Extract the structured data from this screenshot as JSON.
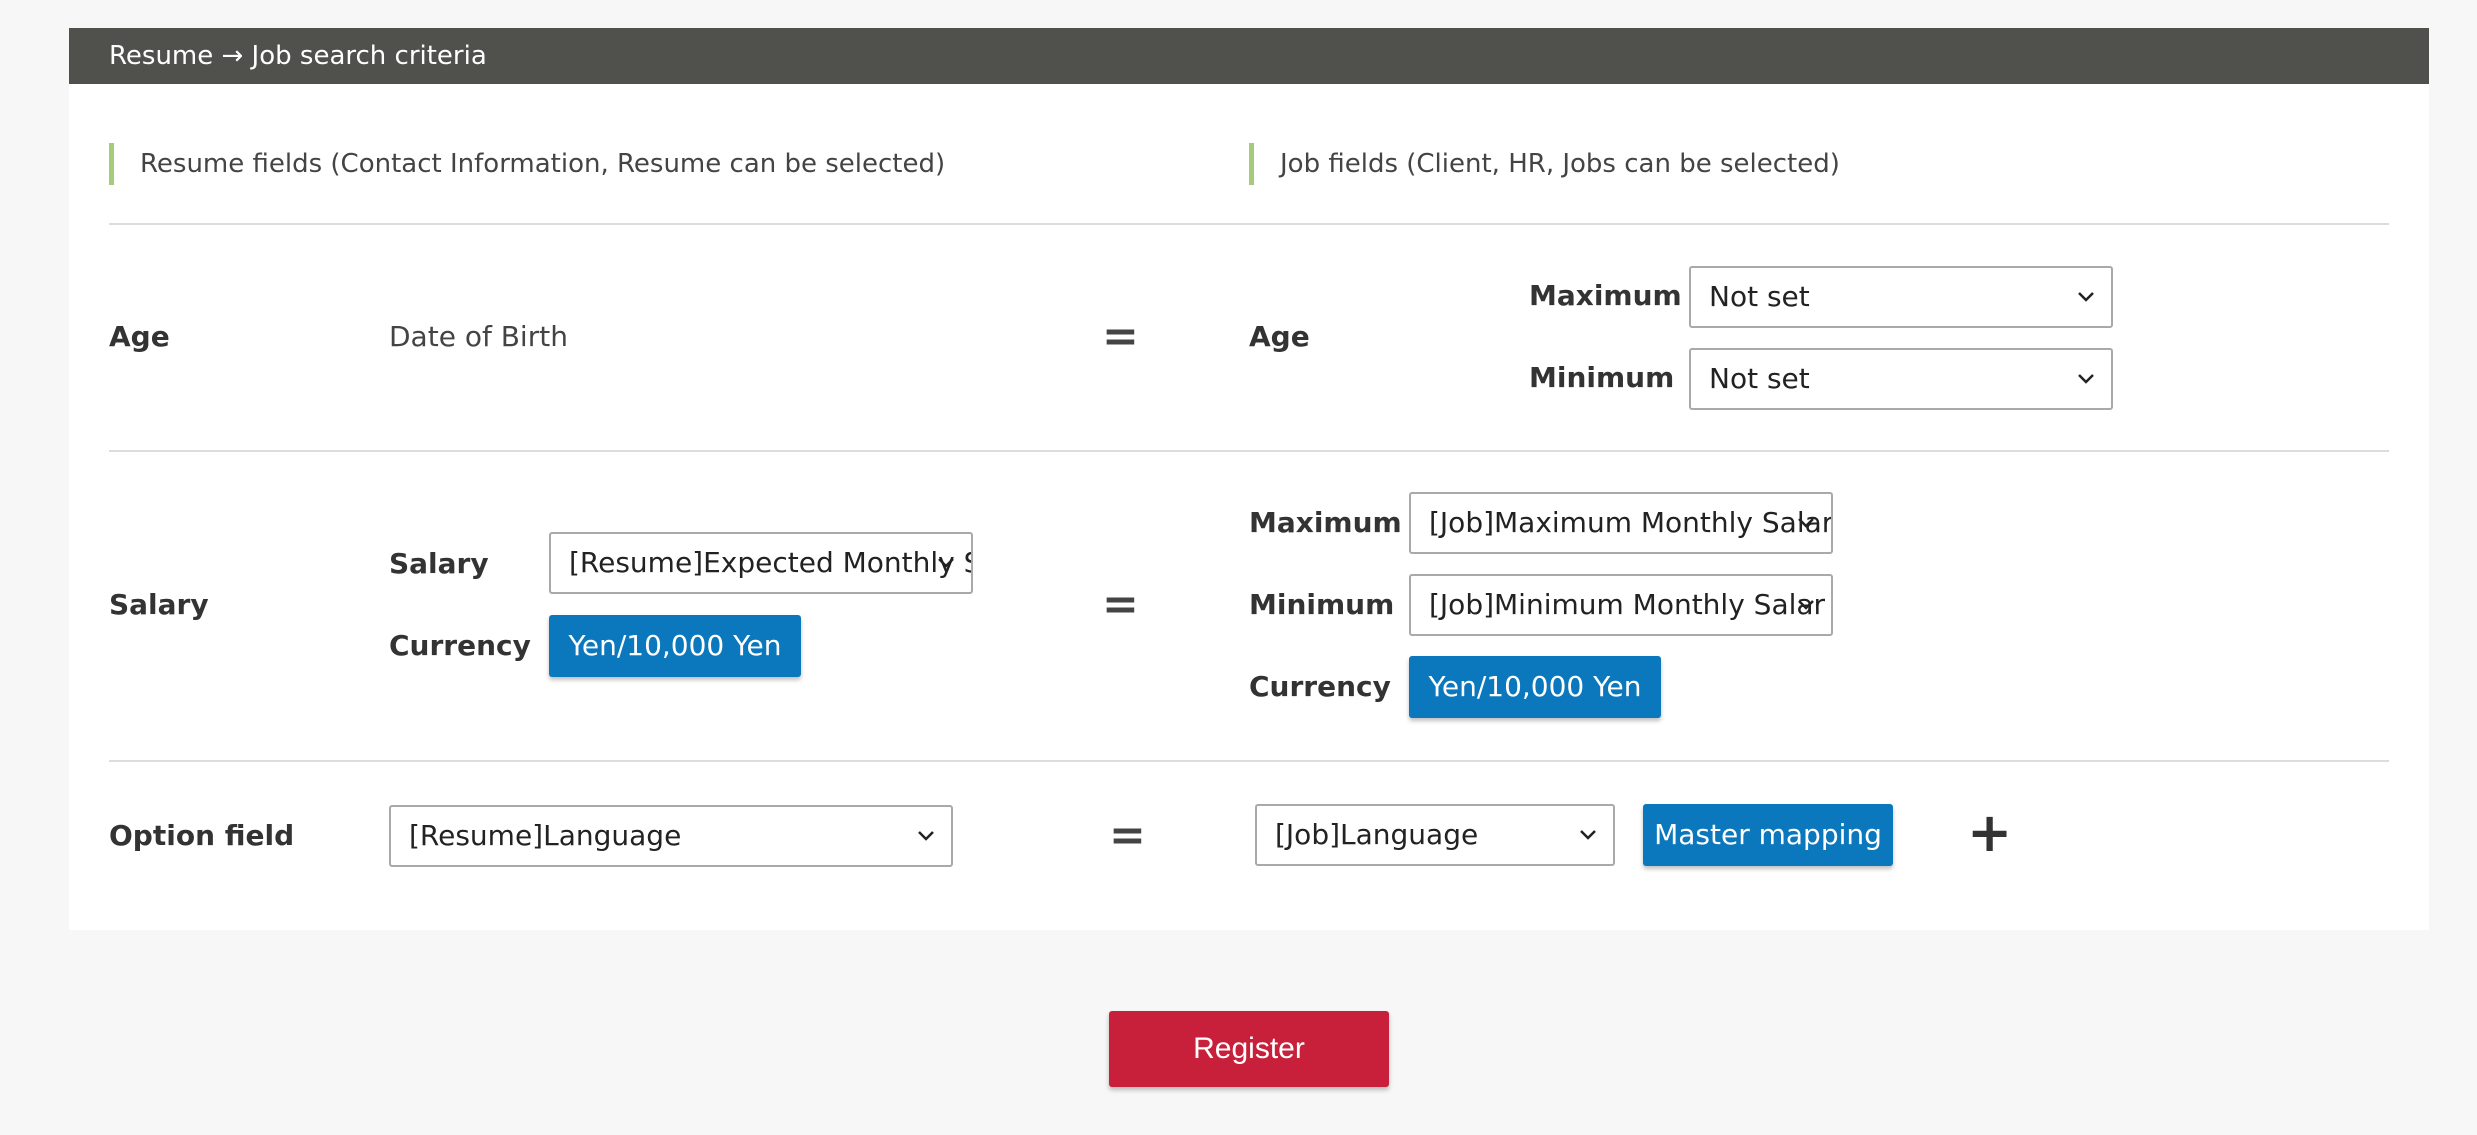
{
  "header": {
    "title": "Resume → Job search criteria"
  },
  "columns": {
    "resume": "Resume fields (Contact Information, Resume can be selected)",
    "job": "Job fields (Client, HR, Jobs can be selected)"
  },
  "age_row": {
    "label": "Age",
    "resume_field": "Date of Birth",
    "equals": "=",
    "job_label": "Age",
    "max_label": "Maximum",
    "max_value": "Not set",
    "min_label": "Minimum",
    "min_value": "Not set"
  },
  "salary_row": {
    "label": "Salary",
    "resume_salary_label": "Salary",
    "resume_salary_value": "[Resume]Expected Monthly S",
    "resume_currency_label": "Currency",
    "resume_currency_button": "Yen/10,000 Yen",
    "equals": "=",
    "job_max_label": "Maximum",
    "job_max_value": "[Job]Maximum Monthly Salar",
    "job_min_label": "Minimum",
    "job_min_value": "[Job]Minimum Monthly Salar",
    "job_currency_label": "Currency",
    "job_currency_button": "Yen/10,000 Yen"
  },
  "option_row": {
    "label": "Option field",
    "resume_value": "[Resume]Language",
    "equals": "=",
    "job_value": "[Job]Language",
    "mapping_button": "Master mapping",
    "add_icon": "+"
  },
  "register_button": "Register",
  "colors": {
    "header_bg": "#50514c",
    "accent_green": "#a6cc7b",
    "button_blue": "#0b78be",
    "button_red": "#c8203a"
  }
}
